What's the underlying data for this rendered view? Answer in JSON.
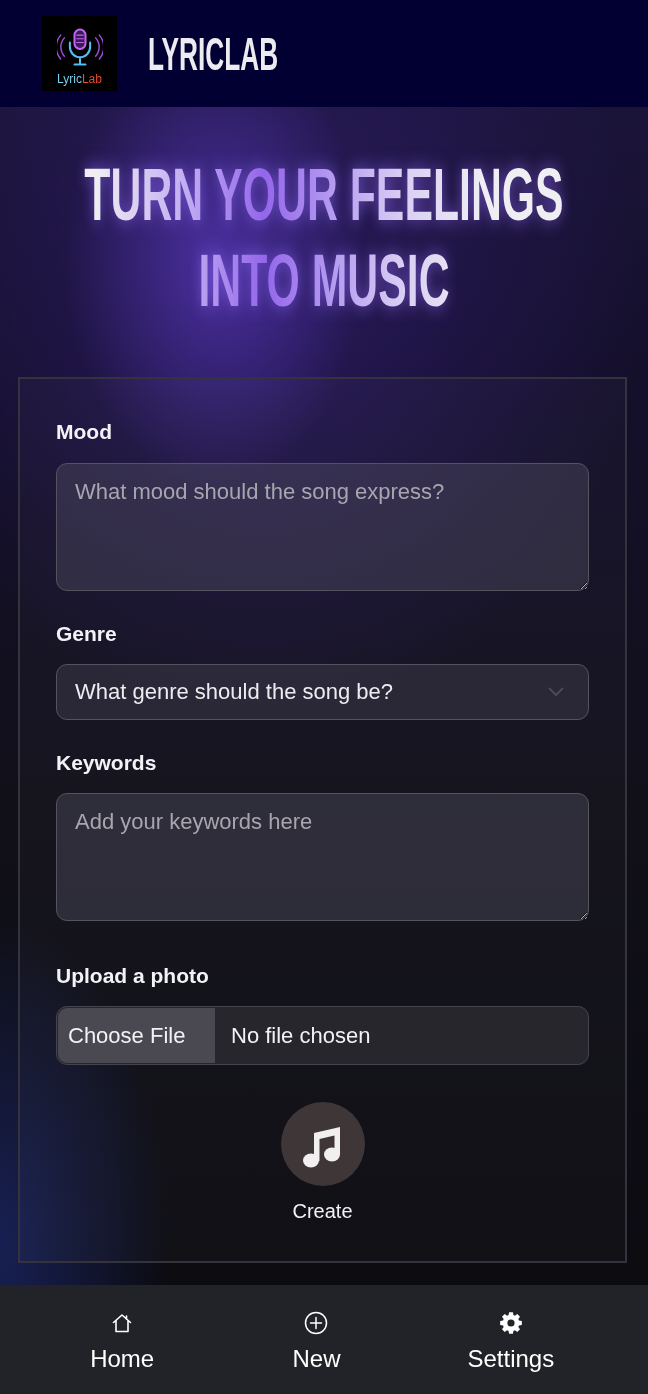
{
  "header": {
    "logo_text": "LyricLab",
    "title": "LYRICLAB"
  },
  "hero": {
    "headline": "TURN YOUR FEELINGS INTO MUSIC"
  },
  "form": {
    "fields": [
      {
        "kind": "textarea",
        "label": "Mood",
        "placeholder": "What mood should the song express?"
      },
      {
        "kind": "select",
        "label": "Genre",
        "value": "What genre should the song be?"
      },
      {
        "kind": "textarea",
        "label": "Keywords",
        "placeholder": "Add your keywords here"
      },
      {
        "kind": "file",
        "label": "Upload a photo",
        "button": "Choose File",
        "status": "No file chosen"
      }
    ],
    "submit": {
      "label": "Create"
    }
  },
  "bottom_nav": {
    "items": [
      {
        "label": "Home"
      },
      {
        "label": "New"
      },
      {
        "label": "Settings"
      }
    ]
  }
}
